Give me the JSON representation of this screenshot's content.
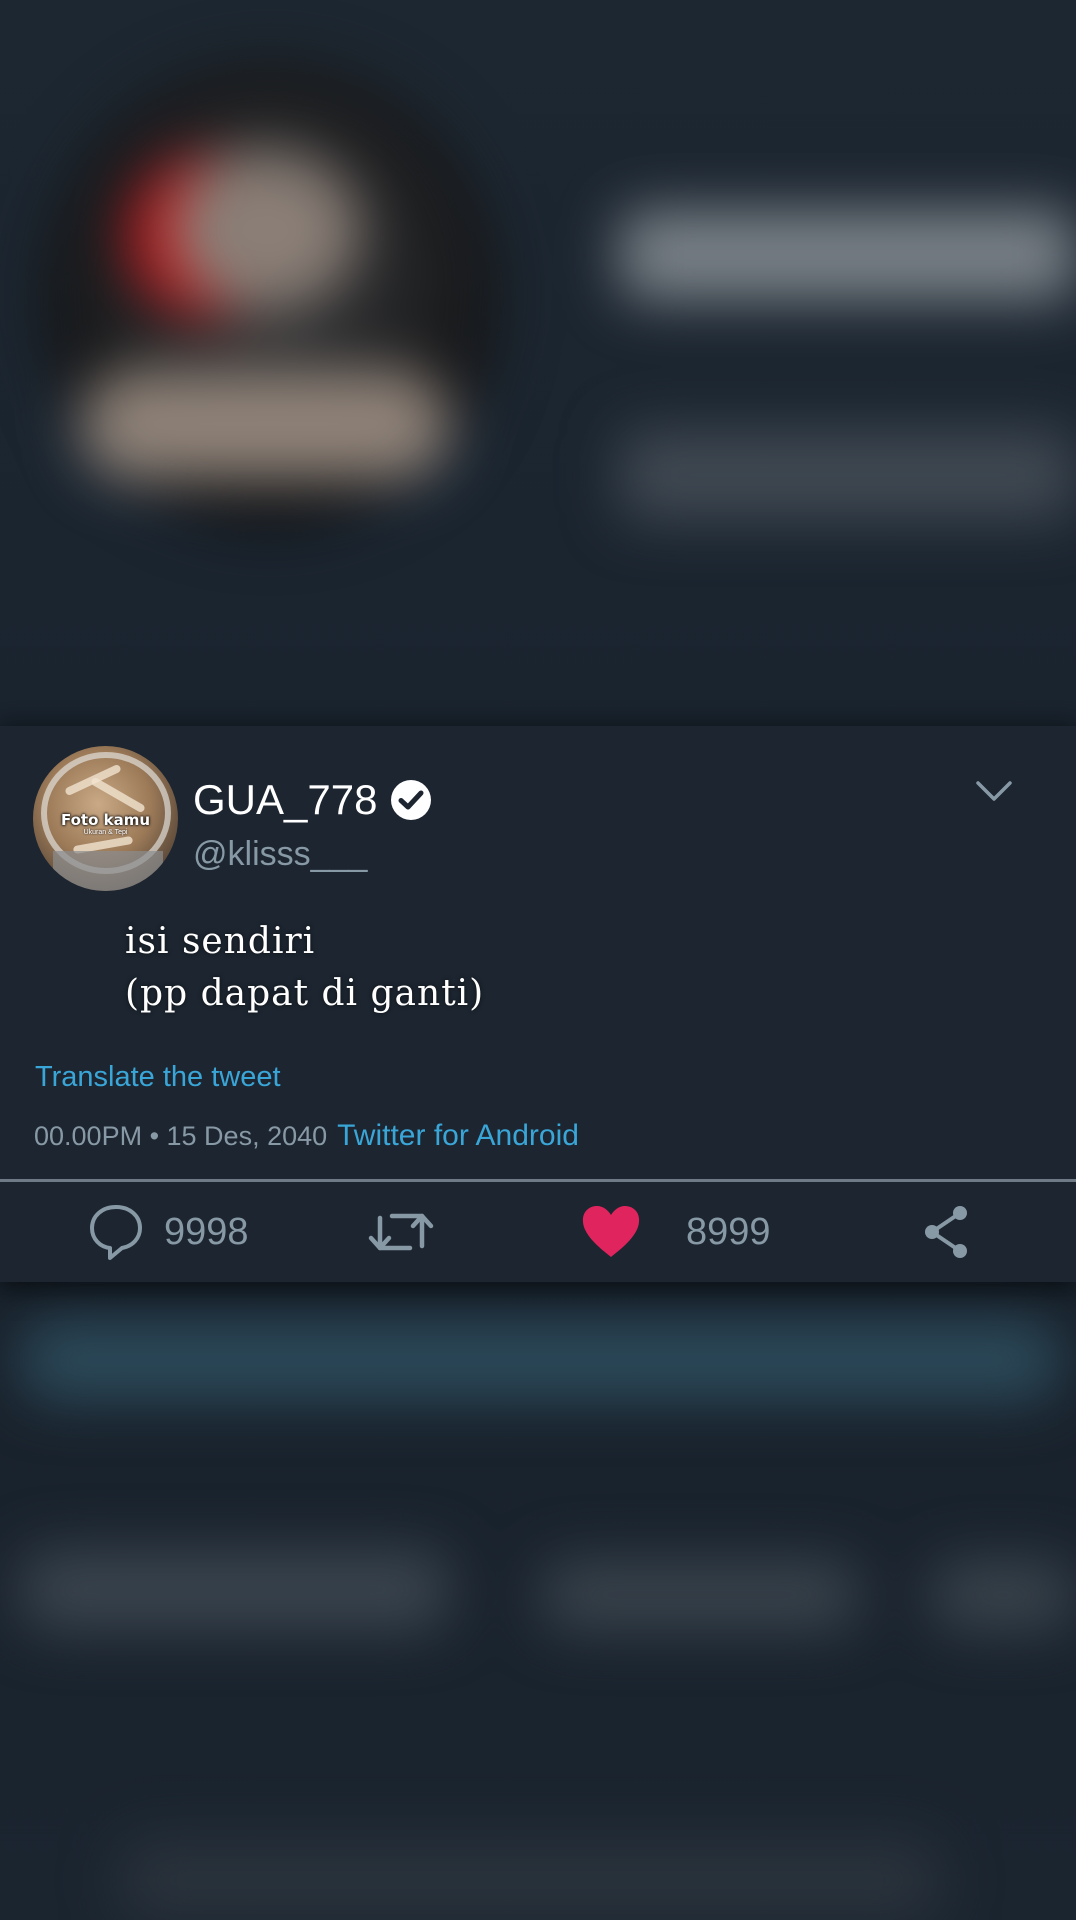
{
  "tweet": {
    "display_name": "GUA_778",
    "handle": "@klisss___",
    "avatar_caption": "Foto kamu",
    "avatar_subcaption": "Ukuran & Tepi",
    "text_line_1": "isi sendiri",
    "text_line_2": "(pp dapat di ganti)",
    "translate_label": "Translate the tweet",
    "timestamp": "00.00PM • 15 Des, 2040",
    "source": "Twitter for Android"
  },
  "actions": {
    "reply_count": "9998",
    "like_count": "8999"
  },
  "icons": {
    "verified": "verified-badge-icon",
    "menu": "chevron-down-icon",
    "reply": "reply-bubble-icon",
    "retweet": "retweet-icon",
    "like": "heart-icon",
    "share": "share-icon"
  },
  "colors": {
    "background": "#1c2530",
    "link": "#3aa6d8",
    "muted": "#8899a6",
    "like": "#e0245e",
    "text": "#ffffff"
  }
}
